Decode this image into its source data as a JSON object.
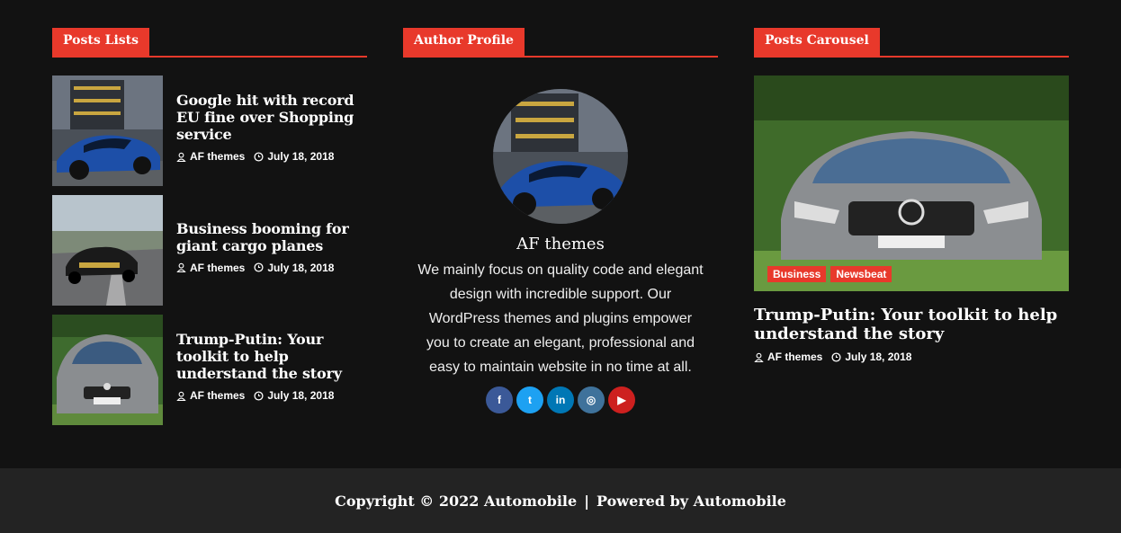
{
  "widgets": {
    "posts_lists_title": "Posts Lists",
    "author_profile_title": "Author Profile",
    "posts_carousel_title": "Posts Carousel"
  },
  "posts": [
    {
      "title": "Google hit with record EU fine over Shopping service",
      "author": "AF themes",
      "date": "July 18, 2018"
    },
    {
      "title": "Business booming for giant cargo planes",
      "author": "AF themes",
      "date": "July 18, 2018"
    },
    {
      "title": "Trump-Putin: Your toolkit to help understand the story",
      "author": "AF themes",
      "date": "July 18, 2018"
    }
  ],
  "author": {
    "name": "AF themes",
    "bio": "We mainly focus on quality code and elegant design with incredible support. Our WordPress themes and plugins empower you to create an elegant, professional and easy to maintain website in no time at all.",
    "social": [
      {
        "icon": "facebook-icon",
        "glyph": "f",
        "color": "#3b5998"
      },
      {
        "icon": "twitter-icon",
        "glyph": "t",
        "color": "#1da1f2"
      },
      {
        "icon": "linkedin-icon",
        "glyph": "in",
        "color": "#0077b5"
      },
      {
        "icon": "instagram-icon",
        "glyph": "◎",
        "color": "#3f729b"
      },
      {
        "icon": "youtube-icon",
        "glyph": "▶",
        "color": "#cd201f"
      }
    ]
  },
  "carousel": {
    "tags": [
      "Business",
      "Newsbeat"
    ],
    "title": "Trump-Putin: Your toolkit to help understand the story",
    "author": "AF themes",
    "date": "July 18, 2018"
  },
  "footer": {
    "copyright": "Copyright © 2022 Automobile",
    "separator": "|",
    "powered": "Powered by Automobile"
  },
  "colors": {
    "accent": "#e8392b",
    "background": "#121212",
    "footer": "#232323"
  }
}
